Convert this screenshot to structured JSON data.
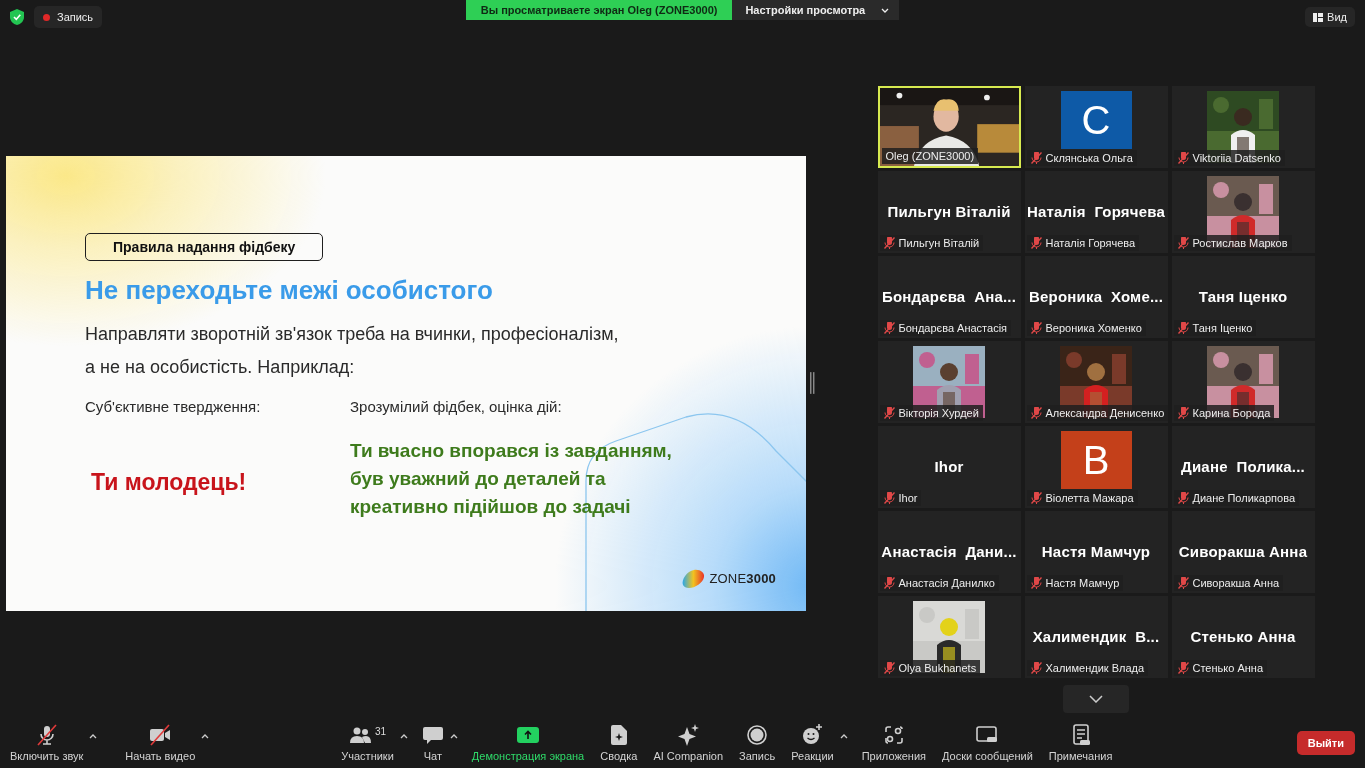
{
  "top_bar": {
    "recording": "Запись",
    "sharing_banner": "Вы просматриваете экран Oleg (ZONE3000)",
    "view_options": "Настройки просмотра",
    "view_button": "Вид"
  },
  "slide": {
    "chip": "Правила надання фідбеку",
    "title": "Не переходьте межі особистого",
    "body_lines": [
      "Направляти зворотній зв'язок треба на вчинки, професіоналізм,",
      "а не на особистість. Наприклад:"
    ],
    "left_label": "Суб'єктивне твердження:",
    "left_example": "Ти молодець!",
    "right_label": "Зрозумілий фідбек, оцінка дій:",
    "right_example_lines": [
      "Ти вчасно впорався із завданням,",
      "був уважний до деталей та",
      "креативно підійшов до задачі"
    ],
    "logo": "ZONE**3000**"
  },
  "gallery": {
    "tiles": [
      {
        "kind": "video",
        "name": "Oleg (ZONE3000)",
        "muted": false,
        "speaking": true
      },
      {
        "kind": "avatar",
        "letter": "С",
        "color": "#0e5aa7",
        "name": "Склянська Ольга",
        "muted": true,
        "speaking": false
      },
      {
        "name": "Viktoriia Datsenko",
        "muted": true,
        "speaking": false
      },
      {
        "kind": "name",
        "display_name": "Пильгун Віталій",
        "name": "Пильгун Віталій",
        "muted": true,
        "speaking": false
      },
      {
        "kind": "name",
        "display_name": "Наталія  Горячева",
        "name": "Наталія Горячева",
        "muted": true,
        "speaking": false
      },
      {
        "name": "Ростислав Марков",
        "muted": true,
        "speaking": false
      },
      {
        "kind": "name",
        "display_name": "Бондарєва  Ана...",
        "name": "Бондарєва Анастасія",
        "muted": true,
        "speaking": false
      },
      {
        "kind": "name",
        "display_name": "Вероника  Хоме...",
        "name": "Вероника Хоменко",
        "muted": true,
        "speaking": false
      },
      {
        "kind": "name",
        "display_name": "Таня Іценко",
        "name": "Таня Іценко",
        "muted": true,
        "speaking": false
      },
      {
        "name": "Вікторія Хурдей",
        "muted": true,
        "speaking": false
      },
      {
        "name": "Александра Денисенко",
        "muted": true,
        "speaking": false
      },
      {
        "name": "Карина Борода",
        "muted": true,
        "speaking": false
      },
      {
        "kind": "name",
        "display_name": "Ihor",
        "name": "Ihor",
        "muted": true,
        "speaking": false
      },
      {
        "kind": "avatar",
        "letter": "В",
        "color": "#c4401a",
        "name": "Віолетта Мажара",
        "muted": true,
        "speaking": false
      },
      {
        "kind": "name",
        "display_name": "Диане  Полика...",
        "name": "Диане Поликарпова",
        "muted": true,
        "speaking": false
      },
      {
        "kind": "name",
        "display_name": "Анастасія  Дани...",
        "name": "Анастасія Данилко",
        "muted": true,
        "speaking": false
      },
      {
        "kind": "name",
        "display_name": "Настя Мамчур",
        "name": "Настя Мамчур",
        "muted": true,
        "speaking": false
      },
      {
        "kind": "name",
        "display_name": "Сиворакша Анна",
        "name": "Сиворакша Анна",
        "muted": true,
        "speaking": false
      },
      {
        "name": "Olya Bukhanets",
        "muted": true,
        "speaking": false
      },
      {
        "kind": "name",
        "display_name": "Халимендик  В...",
        "name": "Халимендик Влада",
        "muted": true,
        "speaking": false
      },
      {
        "kind": "name",
        "display_name": "Стенько Анна",
        "name": "Стенько Анна",
        "muted": true,
        "speaking": false
      }
    ]
  },
  "toolbar": {
    "items": [
      {
        "kind": "mic",
        "label": "Включить звук",
        "off": true,
        "caret": true,
        "active": false
      },
      {
        "kind": "camera",
        "label": "Начать видео",
        "off": true,
        "caret": true,
        "active": false
      },
      {
        "kind": "participants",
        "label": "Участники",
        "count": "31",
        "off": false,
        "caret": true,
        "active": false
      },
      {
        "kind": "chat",
        "label": "Чат",
        "off": false,
        "caret": true,
        "active": false
      },
      {
        "kind": "share",
        "label": "Демонстрация экрана",
        "off": false,
        "caret": false,
        "active": true
      },
      {
        "kind": "summary",
        "label": "Сводка",
        "off": false,
        "caret": false,
        "active": false
      },
      {
        "kind": "sparkle",
        "label": "AI Companion",
        "off": false,
        "caret": false,
        "active": false
      },
      {
        "kind": "record",
        "label": "Запись",
        "off": false,
        "caret": false,
        "active": false
      },
      {
        "kind": "reactions",
        "label": "Реакции",
        "off": false,
        "caret": true,
        "active": false
      },
      {
        "kind": "apps",
        "label": "Приложения",
        "off": false,
        "caret": false,
        "active": false
      },
      {
        "kind": "whiteboard",
        "label": "Доски сообщений",
        "off": false,
        "caret": false,
        "active": false
      },
      {
        "kind": "notes",
        "label": "Примечания",
        "off": false,
        "caret": false,
        "active": false
      }
    ],
    "leave": "Выйти"
  }
}
